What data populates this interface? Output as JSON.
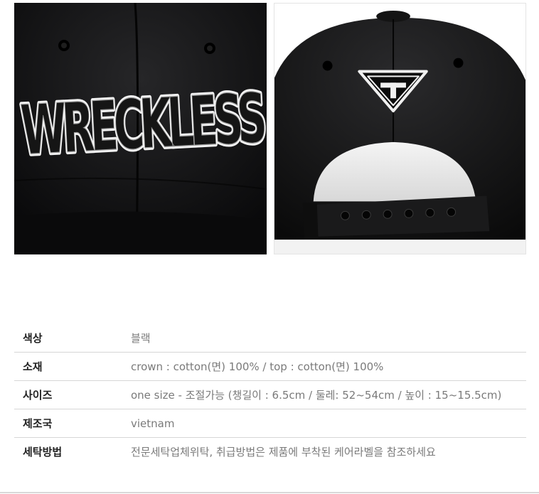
{
  "images": [
    {
      "name": "front-embroidery-photo",
      "embroidery_text": "WRECKLESS",
      "embroidery_color": "#f2f2f2",
      "cap_color": "#111111"
    },
    {
      "name": "back-strap-photo",
      "badge_icon": "inverted-triangle-t-logo",
      "cap_color": "#121212"
    }
  ],
  "specs": [
    {
      "label": "색상",
      "value": "블랙"
    },
    {
      "label": "소재",
      "value": "crown : cotton(면) 100% / top : cotton(면) 100%"
    },
    {
      "label": "사이즈",
      "value": "one size - 조절가능 (챙길이 : 6.5cm / 둘레: 52~54cm / 높이 : 15~15.5cm)"
    },
    {
      "label": "제조국",
      "value": "vietnam"
    },
    {
      "label": "세탁방법",
      "value": "전문세탁업체위탁, 취급방법은 제품에 부착된 케어라벨을 참조하세요"
    }
  ]
}
